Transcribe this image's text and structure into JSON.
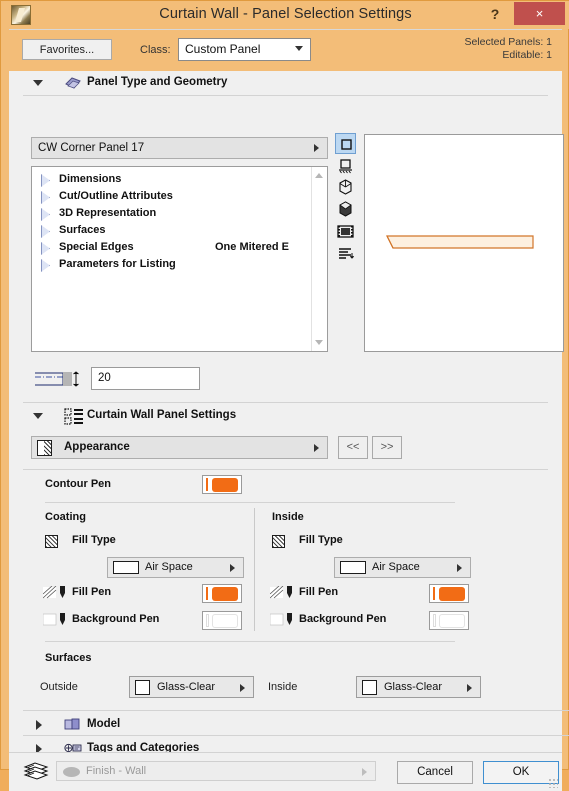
{
  "window": {
    "title": "Curtain Wall - Panel Selection Settings",
    "help_label": "?",
    "close_label": "×",
    "app_icon": "archicad-app-icon",
    "accent_orange": "#f3bd78",
    "close_red": "#c0504d",
    "pen_orange": "#f26c15"
  },
  "toolbar": {
    "favorites_label": "Favorites...",
    "class_label": "Class:",
    "class_value": "Custom Panel",
    "selected_panels": "Selected Panels: 1",
    "editable": "Editable: 1"
  },
  "sections": {
    "geometry": {
      "title": "Panel Type and Geometry",
      "expanded": true,
      "icon": "panel-geometry-icon",
      "object_name": "CW Corner Panel 17",
      "tree": [
        {
          "label": "Dimensions",
          "value": ""
        },
        {
          "label": "Cut/Outline Attributes",
          "value": ""
        },
        {
          "label": "3D Representation",
          "value": ""
        },
        {
          "label": "Surfaces",
          "value": ""
        },
        {
          "label": "Special Edges",
          "value": "One Mitered E"
        },
        {
          "label": "Parameters for Listing",
          "value": ""
        }
      ],
      "view_icons": [
        {
          "name": "2d-symbol-view-icon",
          "selected": true
        },
        {
          "name": "elevation-view-icon",
          "selected": false
        },
        {
          "name": "3d-wireframe-view-icon",
          "selected": false
        },
        {
          "name": "3d-shaded-view-icon",
          "selected": false
        },
        {
          "name": "preview-picture-icon",
          "selected": false
        },
        {
          "name": "parameter-list-icon",
          "selected": false
        }
      ],
      "thickness_value": "20",
      "thickness_icon": "panel-thickness-icon"
    },
    "panel_settings": {
      "title": "Curtain Wall Panel Settings",
      "expanded": true,
      "icon": "panel-settings-icon",
      "appearance_label": "Appearance",
      "nav_prev": "<<",
      "nav_next": ">>",
      "contour_pen_label": "Contour Pen",
      "coating": {
        "title": "Coating",
        "fill_type_label": "Fill Type",
        "fill_type_value": "Air Space",
        "fill_pen_label": "Fill Pen",
        "background_pen_label": "Background Pen"
      },
      "inside": {
        "title": "Inside",
        "fill_type_label": "Fill Type",
        "fill_type_value": "Air Space",
        "fill_pen_label": "Fill Pen",
        "background_pen_label": "Background Pen"
      },
      "surfaces": {
        "title": "Surfaces",
        "outside_label": "Outside",
        "outside_value": "Glass-Clear",
        "inside_label": "Inside",
        "inside_value": "Glass-Clear"
      }
    },
    "model": {
      "title": "Model",
      "expanded": false,
      "icon": "model-icon"
    },
    "tags": {
      "title": "Tags and Categories",
      "expanded": false,
      "icon": "tags-icon"
    }
  },
  "footer": {
    "layer_icon": "layers-icon",
    "layer_value": "Finish - Wall",
    "cancel_label": "Cancel",
    "ok_label": "OK"
  }
}
